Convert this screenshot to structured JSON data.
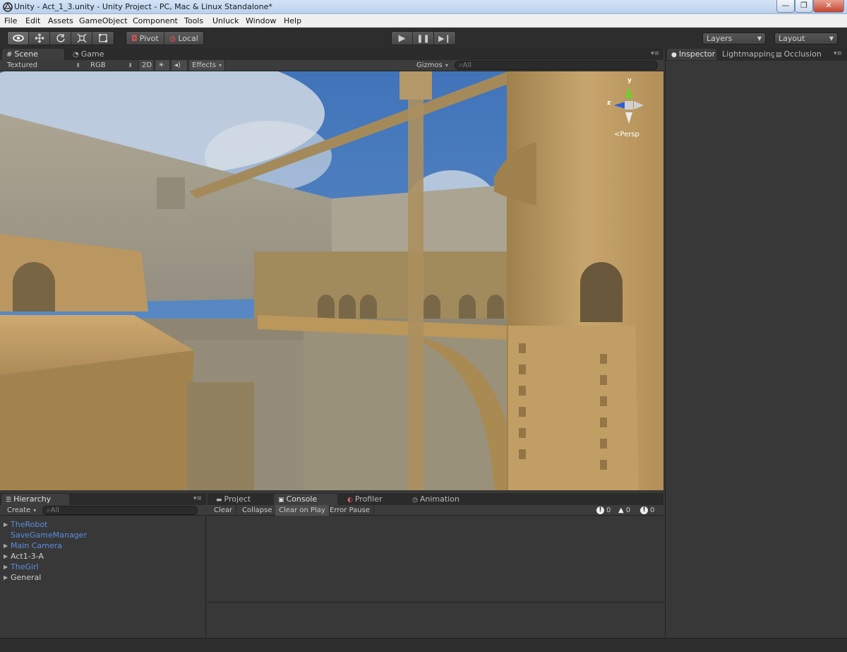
{
  "window": {
    "title": "Unity - Act_1_3.unity - Unity Project - PC, Mac & Linux Standalone*",
    "buttons": {
      "minimize": "—",
      "maximize": "❐",
      "close": "✕"
    }
  },
  "menu": [
    "File",
    "Edit",
    "Assets",
    "GameObject",
    "Component",
    "Tools",
    "Unluck",
    "Window",
    "Help"
  ],
  "toolbar": {
    "pivot_label": "Pivot",
    "local_label": "Local",
    "layers_label": "Layers",
    "layout_label": "Layout"
  },
  "scene": {
    "tabs": [
      "Scene",
      "Game"
    ],
    "render_mode": "Textured",
    "color_mode": "RGB",
    "mode_2d": "2D",
    "effects_label": "Effects",
    "gizmos_label": "Gizmos",
    "search_placeholder": "All",
    "gizmo_axes": {
      "y": "y",
      "z": "z"
    },
    "projection_label": "Persp"
  },
  "inspector": {
    "tabs": [
      "Inspector",
      "Lightmapping",
      "Occlusion"
    ]
  },
  "hierarchy": {
    "tab": "Hierarchy",
    "create_label": "Create",
    "search_placeholder": "All",
    "items": [
      {
        "label": "TheRobot",
        "expandable": true,
        "prefab": true
      },
      {
        "label": "SaveGameManager",
        "expandable": false,
        "prefab": true
      },
      {
        "label": "Main Camera",
        "expandable": true,
        "prefab": true
      },
      {
        "label": "Act1-3-A",
        "expandable": true,
        "prefab": false
      },
      {
        "label": "TheGirl",
        "expandable": true,
        "prefab": true
      },
      {
        "label": "General",
        "expandable": true,
        "prefab": false
      }
    ]
  },
  "console": {
    "tabs": [
      "Project",
      "Console",
      "Profiler",
      "Animation"
    ],
    "buttons": [
      "Clear",
      "Collapse",
      "Clear on Play",
      "Error Pause"
    ],
    "counts": {
      "errors": "0",
      "warnings": "0",
      "logs": "0"
    }
  },
  "colors": {
    "prefab_text": "#5a8fe0",
    "editor_bg": "#383838",
    "sky": "#3b76c4",
    "sandstone": "#b8914f"
  }
}
